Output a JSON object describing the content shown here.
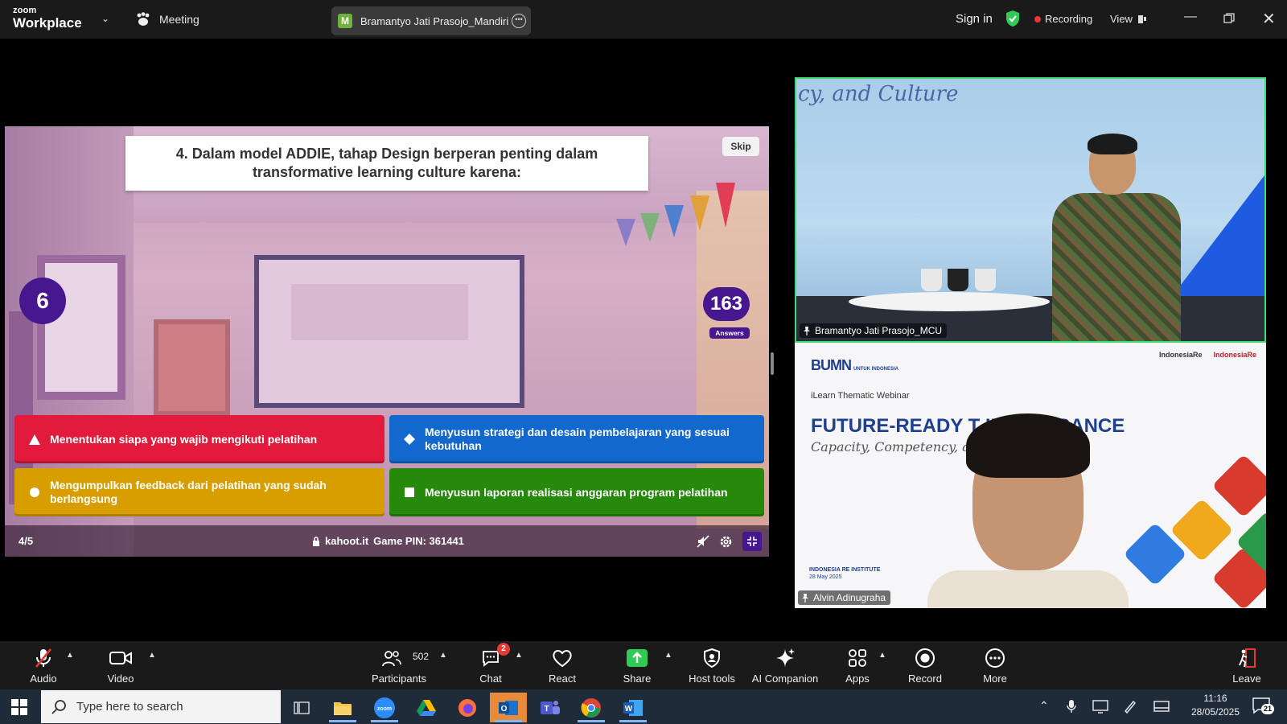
{
  "titlebar": {
    "logo_top": "zoom",
    "logo_bottom": "Workplace",
    "meeting_label": "Meeting",
    "active_speaker_pill": "Bramantyo Jati Prasojo_Mandiri C",
    "pill_avatar_letter": "M",
    "sign_in": "Sign in",
    "recording": "Recording",
    "view": "View"
  },
  "kahoot": {
    "question": "4. Dalam model ADDIE, tahap Design berperan penting dalam transformative learning culture karena:",
    "skip": "Skip",
    "timer": "6",
    "answers_count": "163",
    "answers_label": "Answers",
    "options": [
      {
        "shape": "triangle",
        "color": "#e21b3c",
        "text": "Menentukan siapa yang wajib mengikuti pelatihan"
      },
      {
        "shape": "diamond",
        "color": "#1368ce",
        "text": "Menyusun strategi dan desain pembelajaran yang sesuai kebutuhan"
      },
      {
        "shape": "circle",
        "color": "#d89e00",
        "text": "Mengumpulkan feedback dari pelatihan yang sudah berlangsung"
      },
      {
        "shape": "square",
        "color": "#26890c",
        "text": "Menyusun laporan realisasi anggaran program pelatihan"
      }
    ],
    "progress": "4/5",
    "site": "kahoot.it",
    "pin": "Game PIN: 361441"
  },
  "videos": {
    "top": {
      "name": "Bramantyo Jati Prasojo_MCU",
      "background_text": "cy, and Culture",
      "active_border": "#3ddb70"
    },
    "bottom": {
      "name": "Alvin Adinugraha",
      "bumn": "BUMN",
      "bumn_sub": "UNTUK INDONESIA",
      "ire_logo_1": "IndonesiaRe",
      "ire_logo_2": "IndonesiaRe",
      "ilearn": "iLearn Thematic Webinar",
      "headline": "FUTURE-READY T        IN INSURANCE",
      "sub": "Capacity, Competency, and C",
      "institute": "INDONESIA RE INSTITUTE",
      "date": "28 May 2025"
    }
  },
  "toolbar": {
    "audio": "Audio",
    "video": "Video",
    "participants": "Participants",
    "participants_count": "502",
    "chat": "Chat",
    "chat_badge": "2",
    "react": "React",
    "share": "Share",
    "host_tools": "Host tools",
    "ai_companion": "AI Companion",
    "apps": "Apps",
    "record": "Record",
    "more": "More",
    "leave": "Leave"
  },
  "taskbar": {
    "search_placeholder": "Type here to search",
    "time": "11:16",
    "date": "28/05/2025",
    "notification_count": "21"
  }
}
